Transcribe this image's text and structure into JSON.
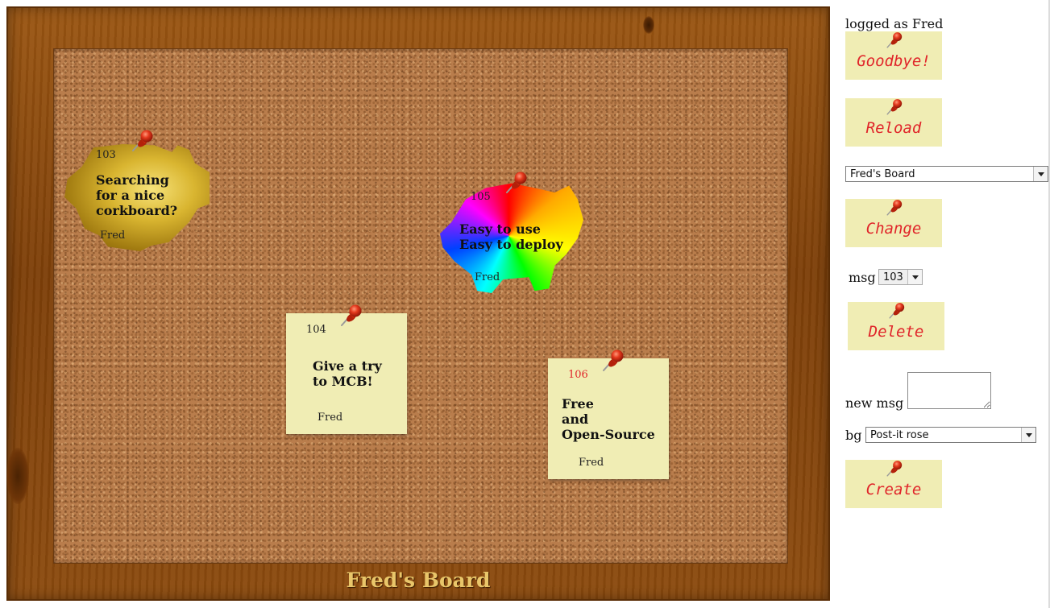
{
  "board": {
    "title": "Fred's Board",
    "notes": [
      {
        "id": "103",
        "text_lines": [
          "Searching",
          "for a nice",
          "corkboard?"
        ],
        "author": "Fred",
        "background": "gold"
      },
      {
        "id": "105",
        "text_lines": [
          "Easy to use",
          "Easy to deploy"
        ],
        "author": "Fred",
        "background": "rainbow"
      },
      {
        "id": "104",
        "text_lines": [
          "Give a try",
          "to MCB!"
        ],
        "author": "Fred",
        "background": "post-it"
      },
      {
        "id": "106",
        "text_lines": [
          "Free",
          "and",
          "Open-Source"
        ],
        "author": "Fred",
        "background": "post-it"
      }
    ]
  },
  "sidebar": {
    "logged_as": "logged as Fred",
    "goodbye_label": "Goodbye!",
    "reload_label": "Reload",
    "board_select_value": "Fred's Board",
    "change_label": "Change",
    "msg_label": "msg",
    "msg_select_value": "103",
    "delete_label": "Delete",
    "new_msg_label": "new msg",
    "new_msg_value": "",
    "bg_label": "bg",
    "bg_select_value": "Post-it rose",
    "create_label": "Create"
  },
  "colors": {
    "button_bg": "#f0edb4",
    "button_text": "#e0252a",
    "selected_note_id": "#e0252a",
    "board_title": "#e9c66a",
    "frame_wood": "#8b4a0e",
    "cork": "#b97d4c"
  },
  "icons": {
    "pin": "pushpin-icon"
  }
}
